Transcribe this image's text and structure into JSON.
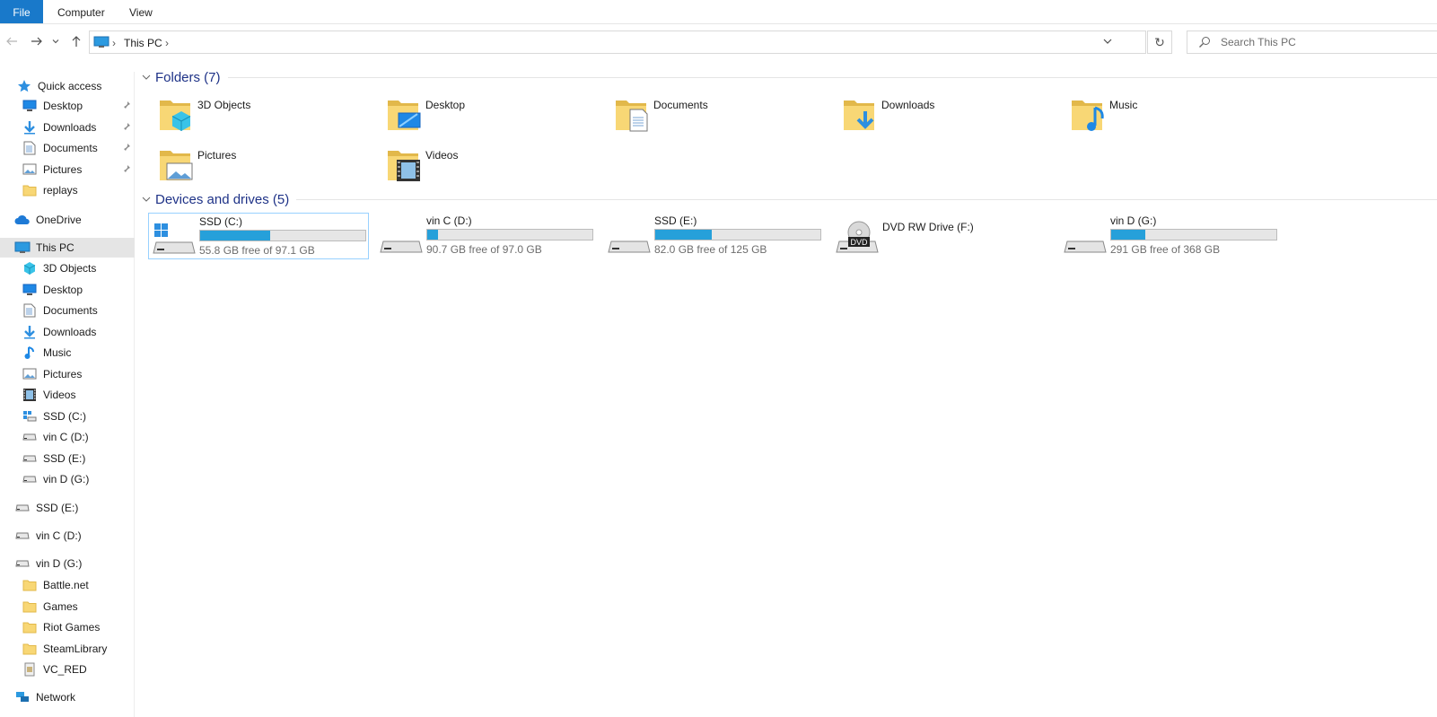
{
  "ribbon": {
    "file": "File",
    "computer": "Computer",
    "view": "View"
  },
  "address": {
    "crumb": "This PC",
    "sep": "›"
  },
  "search": {
    "placeholder": "Search This PC"
  },
  "refresh_glyph": "↻",
  "colors": {
    "accent": "#1979ca",
    "bar_fill": "#26a0da",
    "group_header": "#1e3287",
    "folder_yellow": "#f8d775"
  },
  "sidebar": {
    "quick_access": "Quick access",
    "quick_items": [
      {
        "label": "Desktop",
        "icon": "desktop-icon",
        "pinned": true
      },
      {
        "label": "Downloads",
        "icon": "downloads-icon",
        "pinned": true
      },
      {
        "label": "Documents",
        "icon": "documents-icon",
        "pinned": true
      },
      {
        "label": "Pictures",
        "icon": "pictures-icon",
        "pinned": true
      },
      {
        "label": "replays",
        "icon": "folder-icon",
        "pinned": false
      }
    ],
    "onedrive": "OneDrive",
    "this_pc": "This PC",
    "pc_items": [
      {
        "label": "3D Objects",
        "icon": "3d-objects-icon"
      },
      {
        "label": "Desktop",
        "icon": "desktop-icon"
      },
      {
        "label": "Documents",
        "icon": "documents-icon"
      },
      {
        "label": "Downloads",
        "icon": "downloads-icon"
      },
      {
        "label": "Music",
        "icon": "music-icon"
      },
      {
        "label": "Pictures",
        "icon": "pictures-icon"
      },
      {
        "label": "Videos",
        "icon": "videos-icon"
      },
      {
        "label": "SSD (C:)",
        "icon": "windows-drive-icon"
      },
      {
        "label": "vin C (D:)",
        "icon": "drive-icon"
      },
      {
        "label": "SSD (E:)",
        "icon": "drive-icon"
      },
      {
        "label": "vin D (G:)",
        "icon": "drive-icon"
      }
    ],
    "ssd_e": "SSD (E:)",
    "vin_c": "vin C (D:)",
    "vin_d": "vin D (G:)",
    "vin_d_items": [
      {
        "label": "Battle.net",
        "icon": "folder-icon"
      },
      {
        "label": "Games",
        "icon": "folder-icon"
      },
      {
        "label": "Riot Games",
        "icon": "folder-icon"
      },
      {
        "label": "SteamLibrary",
        "icon": "folder-icon"
      },
      {
        "label": "VC_RED",
        "icon": "file-icon"
      }
    ],
    "network": "Network"
  },
  "folders": {
    "header": "Folders (7)",
    "items": [
      {
        "name": "3D Objects",
        "icon": "3d-objects-folder-icon"
      },
      {
        "name": "Desktop",
        "icon": "desktop-folder-icon"
      },
      {
        "name": "Documents",
        "icon": "documents-folder-icon"
      },
      {
        "name": "Downloads",
        "icon": "downloads-folder-icon"
      },
      {
        "name": "Music",
        "icon": "music-folder-icon"
      },
      {
        "name": "Pictures",
        "icon": "pictures-folder-icon"
      },
      {
        "name": "Videos",
        "icon": "videos-folder-icon"
      }
    ]
  },
  "drives": {
    "header": "Devices and drives (5)",
    "items": [
      {
        "name": "SSD (C:)",
        "free": "55.8 GB free of 97.1 GB",
        "used_fraction": 0.425,
        "icon": "windows-drive-icon",
        "selected": true
      },
      {
        "name": "vin C (D:)",
        "free": "90.7 GB free of 97.0 GB",
        "used_fraction": 0.065,
        "icon": "drive-icon",
        "selected": false
      },
      {
        "name": "SSD (E:)",
        "free": "82.0 GB free of 125 GB",
        "used_fraction": 0.344,
        "icon": "drive-icon",
        "selected": false
      },
      {
        "name": "DVD RW Drive (F:)",
        "free": null,
        "used_fraction": null,
        "icon": "dvd-drive-icon",
        "selected": false,
        "dvd_label": "DVD"
      },
      {
        "name": "vin D (G:)",
        "free": "291 GB free of 368 GB",
        "used_fraction": 0.209,
        "icon": "drive-icon",
        "selected": false
      }
    ]
  }
}
